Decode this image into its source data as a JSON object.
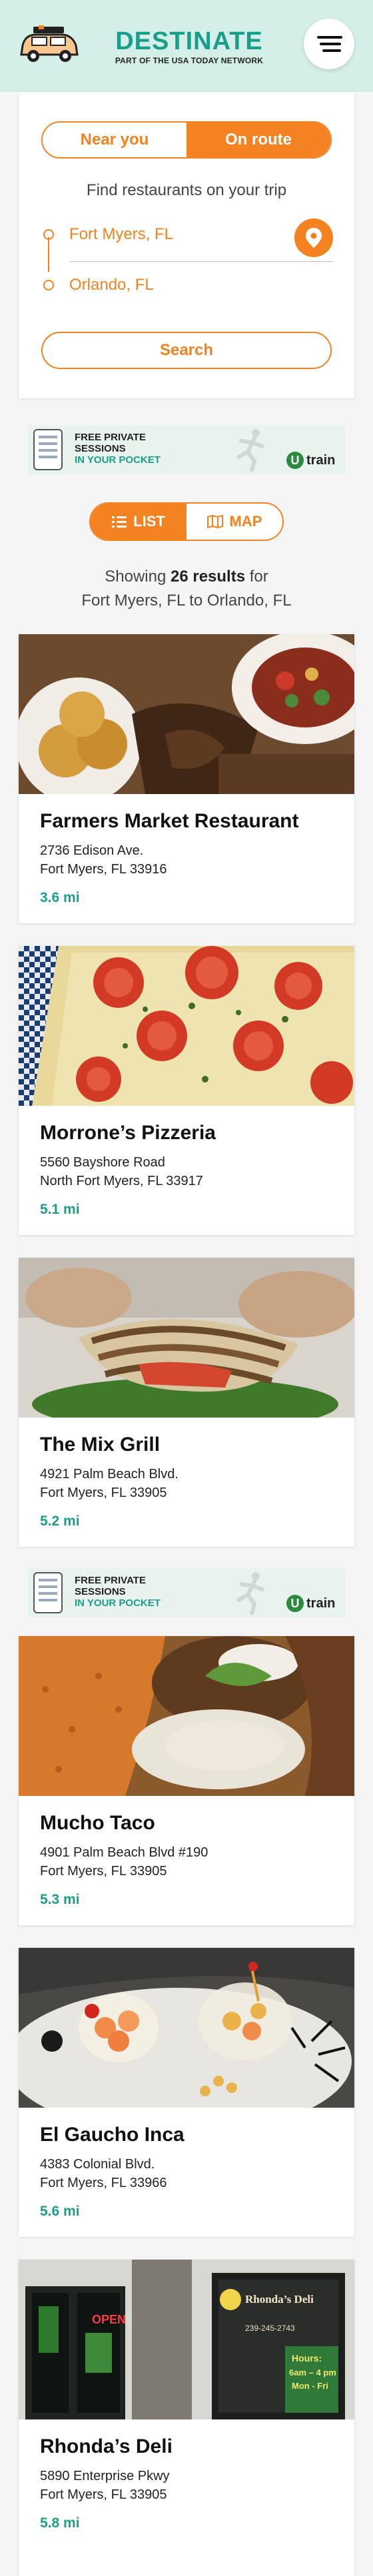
{
  "header": {
    "brand_name": "DESTINATE",
    "brand_sub": "PART OF THE USA TODAY NETWORK"
  },
  "search": {
    "mode_near": "Near you",
    "mode_route": "On route",
    "find_label": "Find restaurants on your trip",
    "from": "Fort Myers, FL",
    "to": "Orlando, FL",
    "search_label": "Search"
  },
  "ad": {
    "line1": "FREE PRIVATE",
    "line2": "SESSIONS",
    "line3": "IN YOUR POCKET",
    "logo_letter": "U",
    "logo_word": "train"
  },
  "view": {
    "list_label": "LIST",
    "map_label": "MAP"
  },
  "results": {
    "prefix": "Showing ",
    "count": "26 results",
    "suffix": " for",
    "route": "Fort Myers, FL to Orlando, FL"
  },
  "restaurants": [
    {
      "name": "Farmers Market Restaurant",
      "addr1": "2736 Edison Ave.",
      "addr2": "Fort Myers, FL 33916",
      "distance": "3.6 mi"
    },
    {
      "name": "Morrone’s Pizzeria",
      "addr1": "5560 Bayshore Road",
      "addr2": "North Fort Myers, FL 33917",
      "distance": "5.1 mi"
    },
    {
      "name": "The Mix Grill",
      "addr1": "4921 Palm Beach Blvd.",
      "addr2": "Fort Myers, FL 33905",
      "distance": "5.2 mi"
    },
    {
      "name": "Mucho Taco",
      "addr1": "4901 Palm Beach Blvd #190",
      "addr2": "Fort Myers, FL 33905",
      "distance": "5.3 mi"
    },
    {
      "name": "El Gaucho Inca",
      "addr1": "4383 Colonial Blvd.",
      "addr2": "Fort Myers, FL 33966",
      "distance": "5.6 mi"
    },
    {
      "name": "Rhonda’s Deli",
      "addr1": "5890 Enterprise Pkwy",
      "addr2": "Fort Myers, FL 33905",
      "distance": "5.8 mi"
    }
  ],
  "photo_text": {
    "deli_sign": "Rhonda’s Deli",
    "deli_phone": "239-245-2743",
    "open_sign": "OPEN",
    "hours_title": "Hours:",
    "hours_range": "6am – 4 pm",
    "hours_days": "Mon - Fri"
  },
  "colors": {
    "accent": "#f58220",
    "teal": "#1a9e8c",
    "header_bg": "#d4efe7"
  }
}
